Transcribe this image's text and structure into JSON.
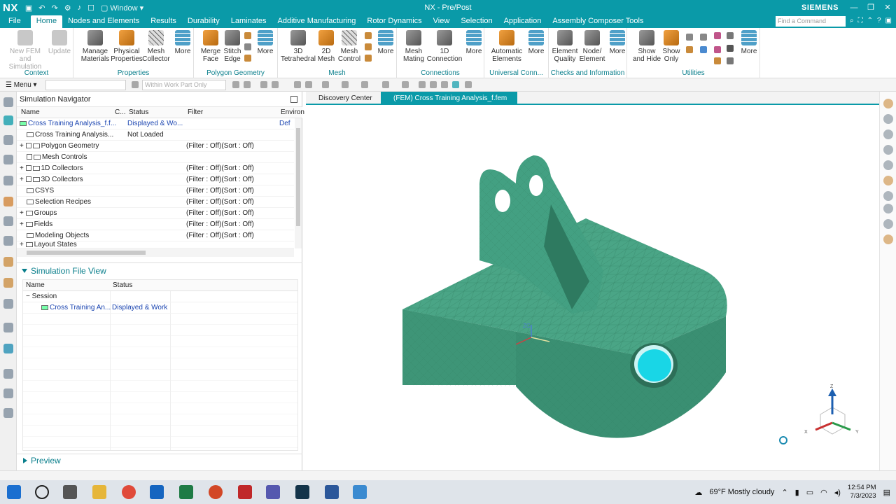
{
  "titlebar": {
    "logo": "NX",
    "window_menu": "Window",
    "title": "NX - Pre/Post",
    "brand": "SIEMENS"
  },
  "menubar": {
    "file": "File",
    "tabs": [
      "Home",
      "Nodes and Elements",
      "Results",
      "Durability",
      "Laminates",
      "Additive Manufacturing",
      "Rotor Dynamics",
      "View",
      "Selection",
      "Application",
      "Assembly Composer Tools"
    ],
    "find_placeholder": "Find a Command"
  },
  "ribbon": {
    "context": {
      "label": "Context",
      "new_fem": "New FEM and Simulation",
      "update": "Update"
    },
    "properties": {
      "label": "Properties",
      "manage": "Manage Materials",
      "physical": "Physical Properties",
      "mesh_collector": "Mesh Collector",
      "more": "More"
    },
    "polygon": {
      "label": "Polygon Geometry",
      "merge": "Merge Face",
      "stitch": "Stitch Edge",
      "more": "More"
    },
    "mesh": {
      "label": "Mesh",
      "m3d": "3D Tetrahedral",
      "m2d": "2D Mesh",
      "control": "Mesh Control",
      "more": "More"
    },
    "connections": {
      "label": "Connections",
      "mating": "Mesh Mating",
      "conn1d": "1D Connection",
      "more": "More"
    },
    "universal": {
      "label": "Universal Conn...",
      "auto": "Automatic Elements",
      "more": "More"
    },
    "checks": {
      "label": "Checks and Information",
      "quality": "Element Quality",
      "node": "Node/ Element",
      "more": "More"
    },
    "utilities": {
      "label": "Utilities",
      "showhide": "Show and Hide",
      "showonly": "Show Only",
      "more": "More"
    }
  },
  "toolbar2": {
    "menu": "Menu",
    "filter_combo": "",
    "scope_combo": "Within Work Part Only"
  },
  "navigator": {
    "title": "Simulation Navigator",
    "columns": {
      "name": "Name",
      "c": "C...",
      "status": "Status",
      "filter": "Filter",
      "env": "Environ"
    },
    "rows": [
      {
        "name": "Cross Training Analysis_f.f...",
        "status": "Displayed & Wo...",
        "filter": "",
        "env": "Def"
      },
      {
        "name": "Cross Training Analysis...",
        "status": "Not Loaded",
        "filter": "",
        "env": ""
      },
      {
        "name": "Polygon Geometry",
        "status": "",
        "filter": "(Filter : Off)(Sort : Off)",
        "env": ""
      },
      {
        "name": "Mesh Controls",
        "status": "",
        "filter": "",
        "env": ""
      },
      {
        "name": "1D Collectors",
        "status": "",
        "filter": "(Filter : Off)(Sort : Off)",
        "env": ""
      },
      {
        "name": "3D Collectors",
        "status": "",
        "filter": "(Filter : Off)(Sort : Off)",
        "env": ""
      },
      {
        "name": "CSYS",
        "status": "",
        "filter": "(Filter : Off)(Sort : Off)",
        "env": ""
      },
      {
        "name": "Selection Recipes",
        "status": "",
        "filter": "(Filter : Off)(Sort : Off)",
        "env": ""
      },
      {
        "name": "Groups",
        "status": "",
        "filter": "(Filter : Off)(Sort : Off)",
        "env": ""
      },
      {
        "name": "Fields",
        "status": "",
        "filter": "(Filter : Off)(Sort : Off)",
        "env": ""
      },
      {
        "name": "Modeling Objects",
        "status": "",
        "filter": "(Filter : Off)(Sort : Off)",
        "env": ""
      },
      {
        "name": "Layout States",
        "status": "",
        "filter": "",
        "env": ""
      }
    ]
  },
  "file_view": {
    "title": "Simulation File View",
    "columns": {
      "name": "Name",
      "status": "Status"
    },
    "session": "Session",
    "file": {
      "name": "Cross Training An...",
      "status": "Displayed & Work"
    }
  },
  "preview": "Preview",
  "tabs": {
    "discovery": "Discovery Center",
    "fem": "(FEM) Cross Training Analysis_f.fem"
  },
  "triad": {
    "x": "X",
    "y": "Y",
    "z": "Z",
    "zc": "ZC"
  },
  "taskbar": {
    "weather": "69°F  Mostly cloudy",
    "time": "12:54 PM",
    "date": "7/3/2023"
  },
  "colors": {
    "accent": "#0a9aa8",
    "mesh": "#3f9a7a"
  }
}
